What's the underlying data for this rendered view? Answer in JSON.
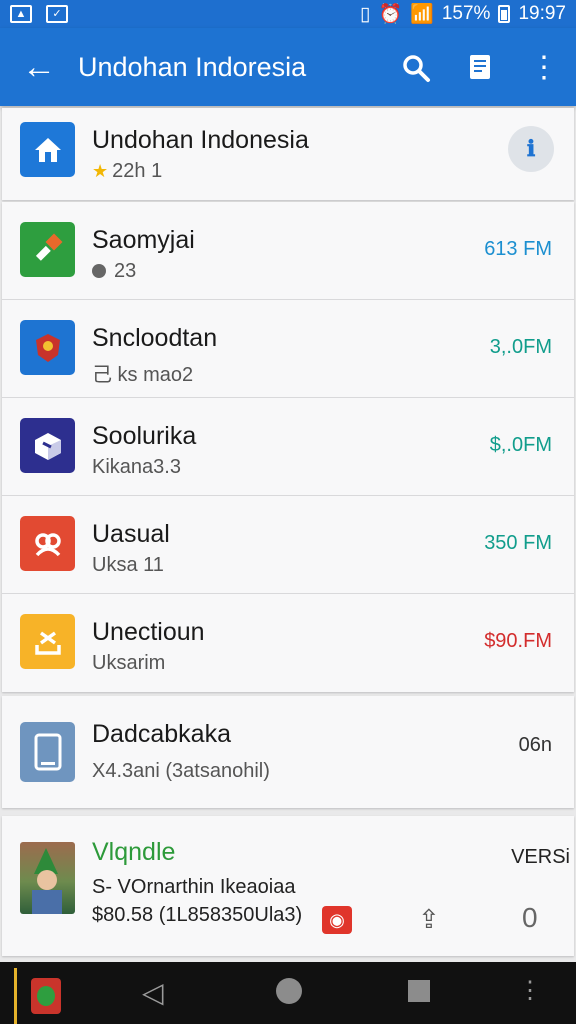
{
  "status_bar": {
    "percent": "157%",
    "time": "19:97"
  },
  "app_bar": {
    "title": "Undohan Indoresia"
  },
  "header_item": {
    "title": "Undohan Indonesia",
    "rating": "22h 1"
  },
  "items": [
    {
      "name": "Saomyjai",
      "sub": "23",
      "value": "613 FM",
      "value_color": "#1c8fd0",
      "icon_color": "#2e9e3f"
    },
    {
      "name": "Sncloodtan",
      "sub": "⼰ ks mao2",
      "value": "3,.0FM",
      "value_color": "#119d8c",
      "icon_color": "#1e74d2"
    },
    {
      "name": "Soolurika",
      "sub": "Kikana3.3",
      "value": "$,.0FM",
      "value_color": "#119d8c",
      "icon_color": "#2d2f8f"
    },
    {
      "name": "Uasual",
      "sub": "Uksa 11",
      "value": "350 FM",
      "value_color": "#119d8c",
      "icon_color": "#e24a32"
    },
    {
      "name": "Unectioun",
      "sub": "Uksarim",
      "value": "$90.FM",
      "value_color": "#d32d2d",
      "icon_color": "#f7b328"
    }
  ],
  "download_item": {
    "name": "Dadcabkaka",
    "sub": "X4.3ani (3atsanohil)",
    "value": "06n"
  },
  "bottom_card": {
    "name": "Vlqndle",
    "line1": "S- VOrnarthin Ikeaoiaa",
    "line2": "$80.58 (1L858350Ula3)",
    "value": "VERSi"
  },
  "colors": {
    "primary": "#1e73d2",
    "green_title": "#2d9a3a"
  }
}
